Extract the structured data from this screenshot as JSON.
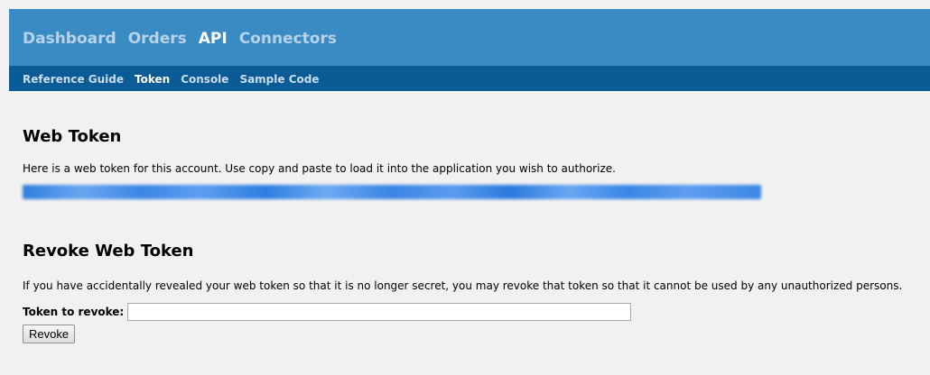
{
  "top_nav": {
    "items": [
      {
        "label": "Dashboard"
      },
      {
        "label": "Orders"
      },
      {
        "label": "API"
      },
      {
        "label": "Connectors"
      }
    ],
    "active": "API"
  },
  "sub_nav": {
    "items": [
      {
        "label": "Reference Guide"
      },
      {
        "label": "Token"
      },
      {
        "label": "Console"
      },
      {
        "label": "Sample Code"
      }
    ],
    "active": "Token"
  },
  "web_token": {
    "heading": "Web Token",
    "description": "Here is a web token for this account. Use copy and paste to load it into the application you wish to authorize."
  },
  "revoke": {
    "heading": "Revoke Web Token",
    "description": "If you have accidentally revealed your web token so that it is no longer secret, you may revoke that token so that it cannot be used by any unauthorized persons.",
    "field_label": "Token to revoke:",
    "field_value": "",
    "button_label": "Revoke"
  },
  "colors": {
    "top_nav_bg": "#3a8ac4",
    "sub_nav_bg": "#0b5b96",
    "page_bg": "#f1f1f1"
  }
}
